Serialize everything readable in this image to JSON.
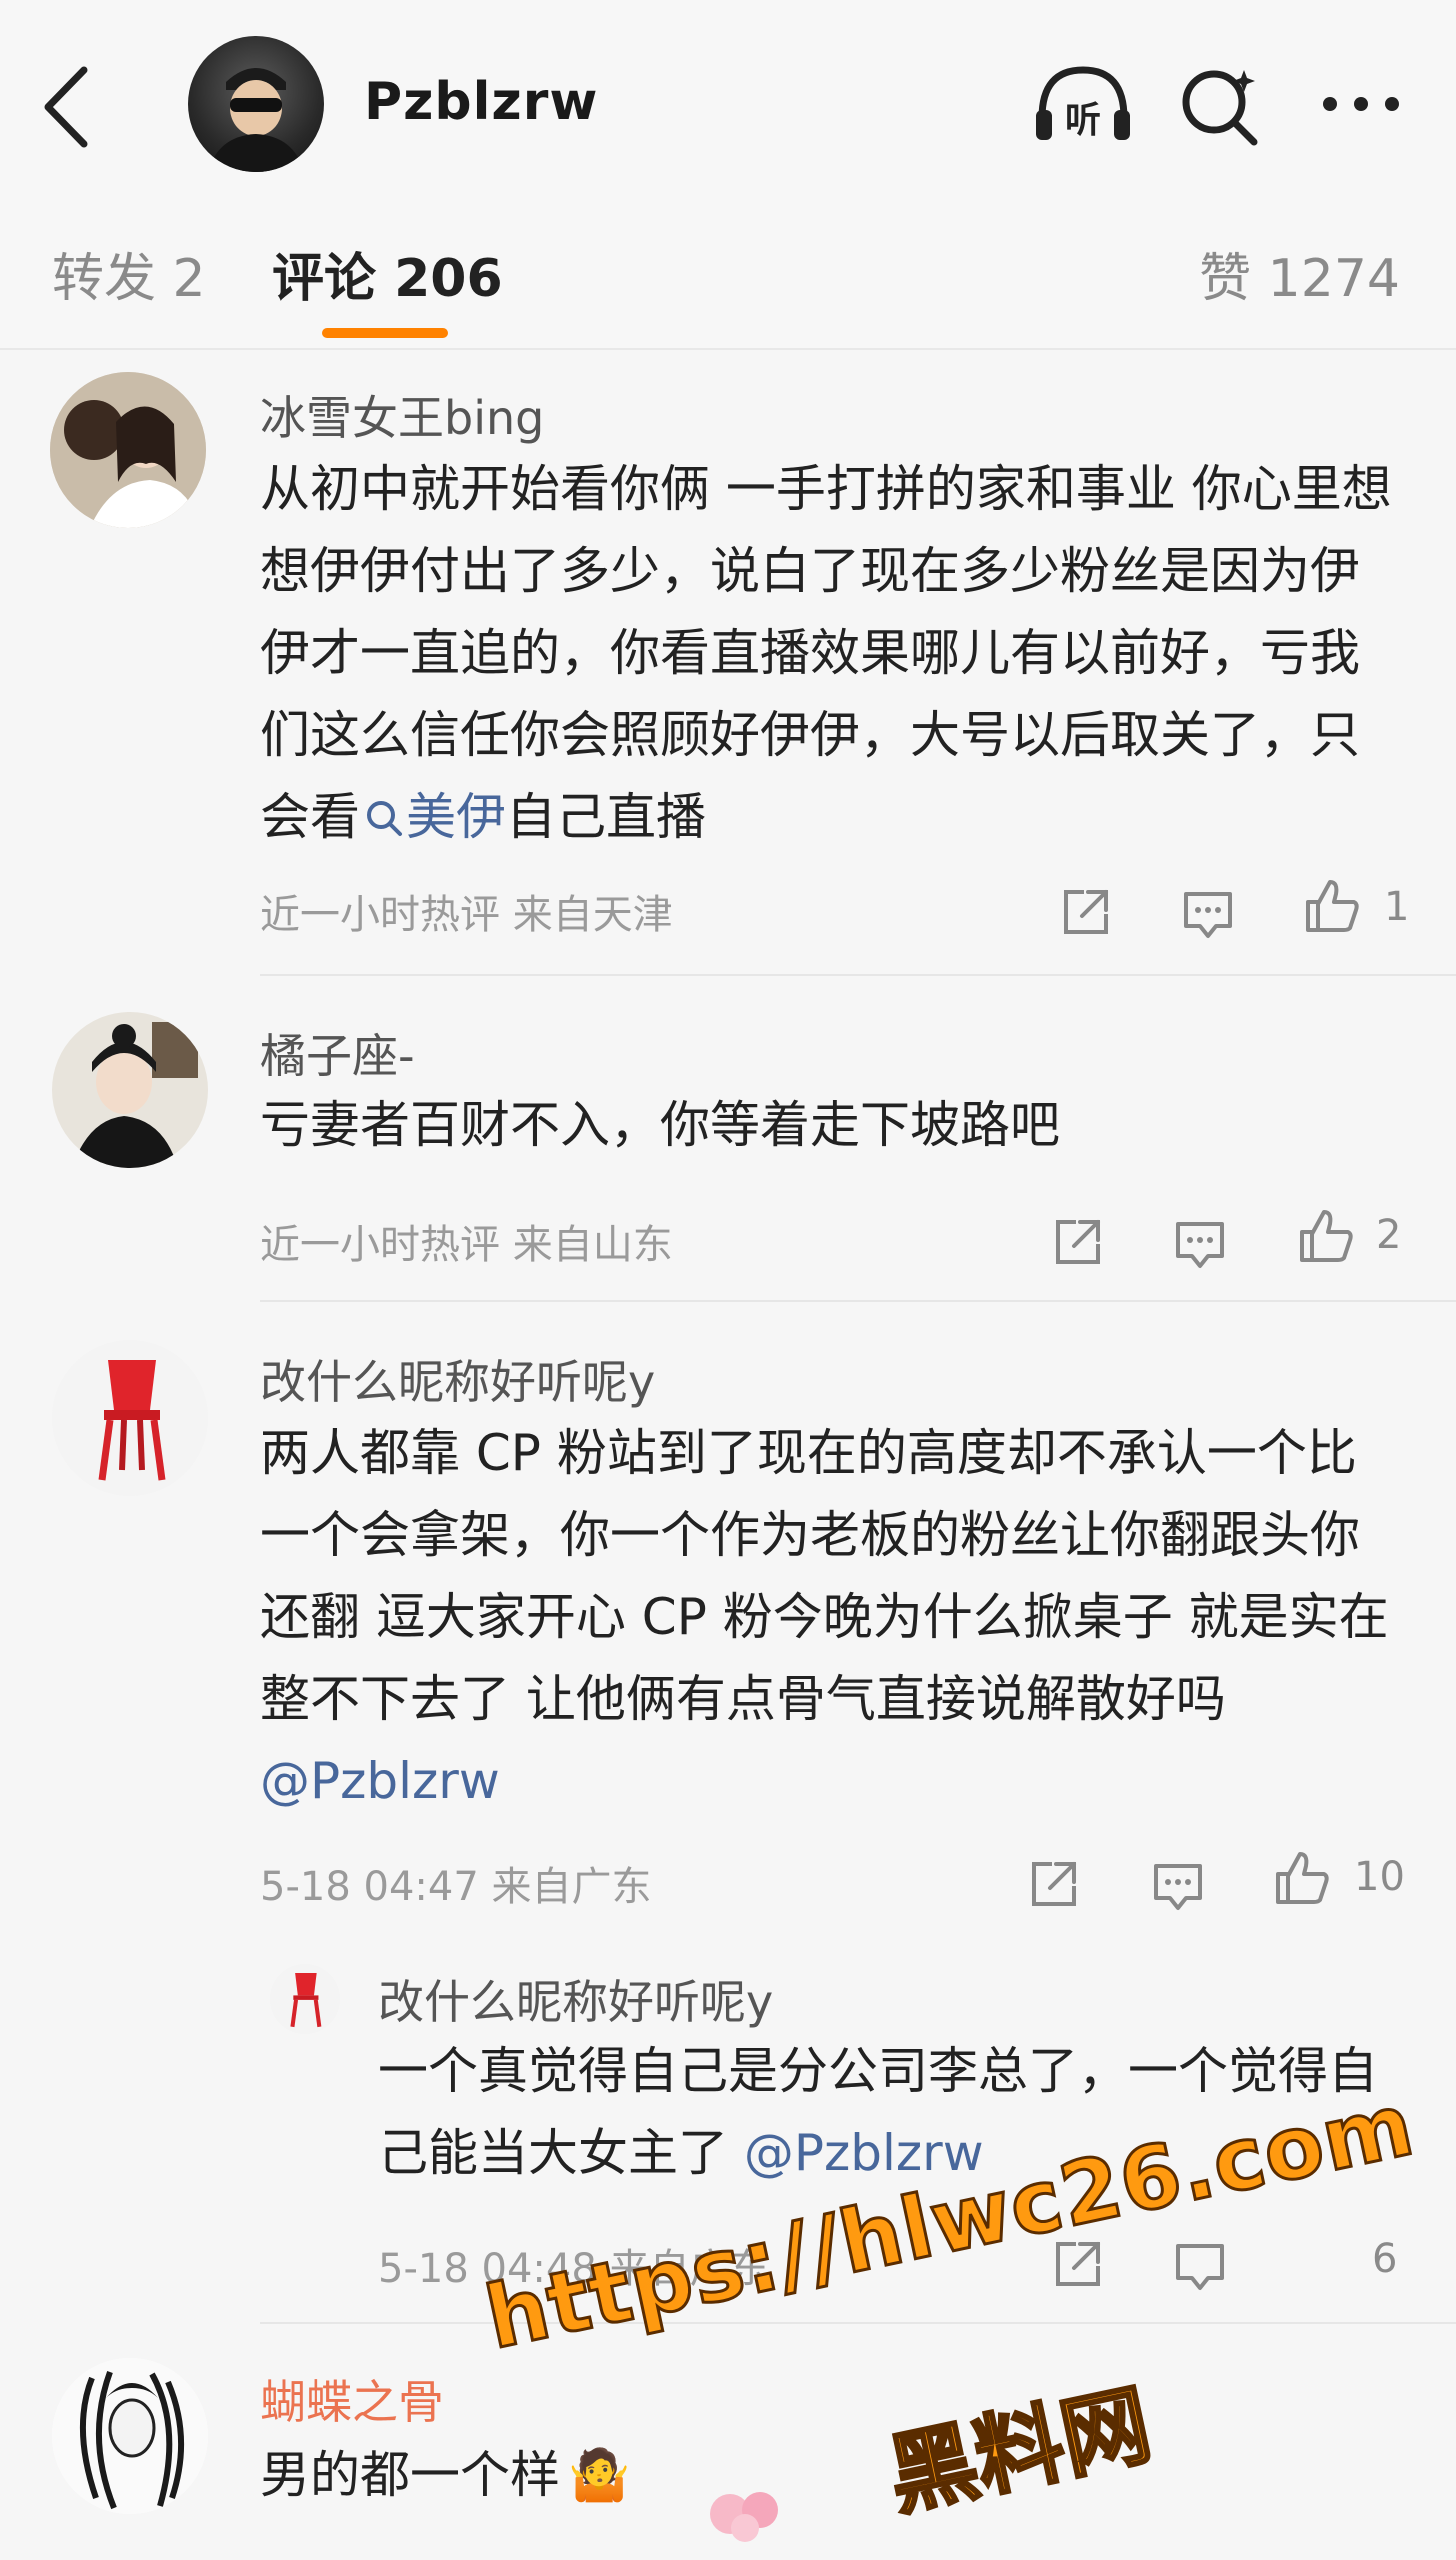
{
  "header": {
    "back_icon": "chevron-left-icon",
    "username": "Pzblzrw",
    "listen_label": "听",
    "search_icon": "search-sparkle-icon",
    "more_icon": "more-dots-icon"
  },
  "tabs": {
    "repost": "转发 2",
    "comment": "评论 206",
    "like": "赞 1274",
    "accent": "#ff8200"
  },
  "comments": [
    {
      "name": "冰雪女王bing",
      "text_before_link": "从初中就开始看你俩 一手打拼的家和事业 你心里想想伊伊付出了多少，说白了现在多少粉丝是因为伊伊才一直追的，你看直播效果哪儿有以前好，亏我们这么信任你会照顾好伊伊，大号以后取关了，只会看",
      "link_text": "美伊",
      "text_after_link": "自己直播",
      "meta": "近一小时热评  来自天津",
      "likes": "1"
    },
    {
      "name": "橘子座-",
      "text": "亏妻者百财不入，你等着走下坡路吧",
      "meta": "近一小时热评  来自山东",
      "likes": "2"
    },
    {
      "name": "改什么昵称好听呢y",
      "text_before_link": "两人都靠 CP 粉站到了现在的高度却不承认一个比一个会拿架，你一个作为老板的粉丝让你翻跟头你还翻 逗大家开心 CP 粉今晚为什么掀桌子 就是实在整不下去了 让他俩有点骨气直接说解散好吗",
      "link_text": "@Pzblzrw",
      "meta": "5-18 04:47  来自广东",
      "likes": "10",
      "reply": {
        "name": "改什么昵称好听呢y",
        "text_before_link": "一个真觉得自己是分公司李总了，一个觉得自己能当大女主了",
        "link_text": "@Pzblzrw",
        "meta": "5-18 04:48  来自广东",
        "likes": "6"
      }
    },
    {
      "name": "蝴蝶之骨",
      "text": "男的都一个样",
      "emoji": "🤷",
      "name_color": "#eb7350"
    }
  ],
  "watermark": {
    "url": "https://hlwc26.com",
    "name": "黑料网"
  },
  "colors": {
    "link": "#48679b",
    "meta": "#9a9a9a"
  }
}
